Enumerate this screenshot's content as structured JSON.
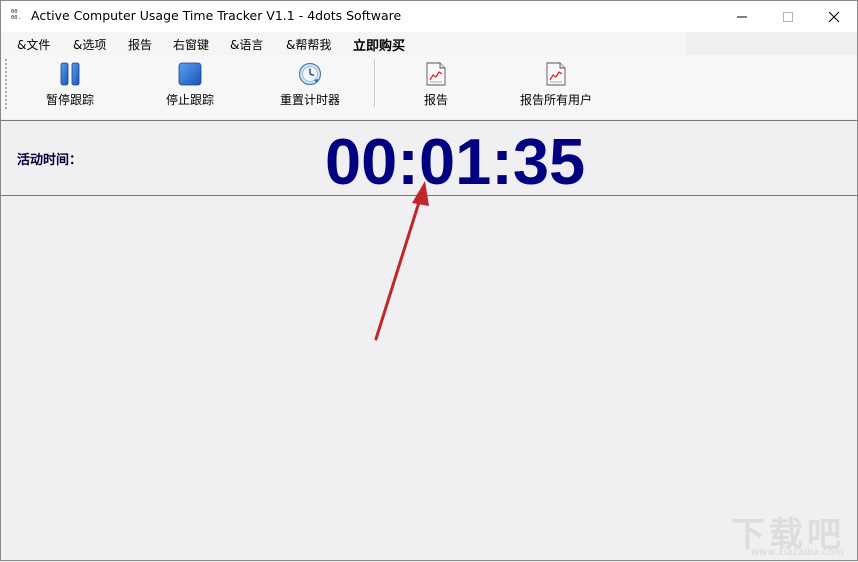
{
  "window": {
    "title": "Active Computer Usage Time Tracker V1.1 - 4dots Software",
    "app_icon_glyph": "00\n00.\n00.",
    "controls": {
      "minimize": "—",
      "maximize": "☐",
      "close": "✕"
    }
  },
  "menubar": {
    "items": [
      {
        "label": "&文件"
      },
      {
        "label": "&选项"
      },
      {
        "label": "报告"
      },
      {
        "label": "右窗键"
      },
      {
        "label": "&语言"
      },
      {
        "label": "&帮帮我"
      },
      {
        "label": "立即购买"
      }
    ]
  },
  "toolbar": {
    "buttons": [
      {
        "label": "暂停跟踪",
        "icon": "pause-icon"
      },
      {
        "label": "停止跟踪",
        "icon": "stop-icon"
      },
      {
        "label": "重置计时器",
        "icon": "reset-timer-icon"
      },
      {
        "label": "报告",
        "icon": "report-icon"
      },
      {
        "label": "报告所有用户",
        "icon": "report-all-users-icon"
      }
    ]
  },
  "status": {
    "active_time_label": "活动时间：",
    "timer_value": "00:01:35"
  },
  "watermark": {
    "text": "下载吧",
    "url": "www.xiazaiba.com"
  },
  "colors": {
    "timer": "#000080",
    "icon_blue": "#2a6fd6",
    "arrow": "#c0262a"
  }
}
